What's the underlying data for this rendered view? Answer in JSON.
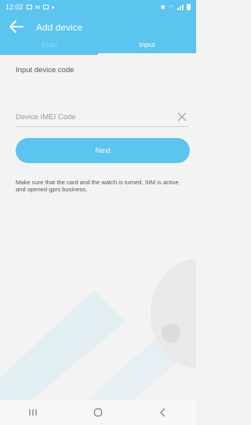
{
  "status_bar": {
    "time": "12:02"
  },
  "app_bar": {
    "title": "Add device",
    "back_icon": "arrow-left-icon"
  },
  "tabs": [
    {
      "label": "Scan",
      "active": false
    },
    {
      "label": "Input",
      "active": true
    }
  ],
  "form": {
    "label": "Input device code",
    "imei_placeholder": "Device IMEI Code",
    "imei_value": "",
    "clear_icon": "close-icon",
    "next_label": "Next",
    "hint": "Make sure that the card and the watch is turned, SIM is active and opened gprs business."
  },
  "nav_bar": {
    "icons": [
      "recent-apps-icon",
      "home-icon",
      "back-icon"
    ]
  },
  "colors": {
    "accent": "#5bc4ef",
    "background": "#f3f3f3"
  }
}
